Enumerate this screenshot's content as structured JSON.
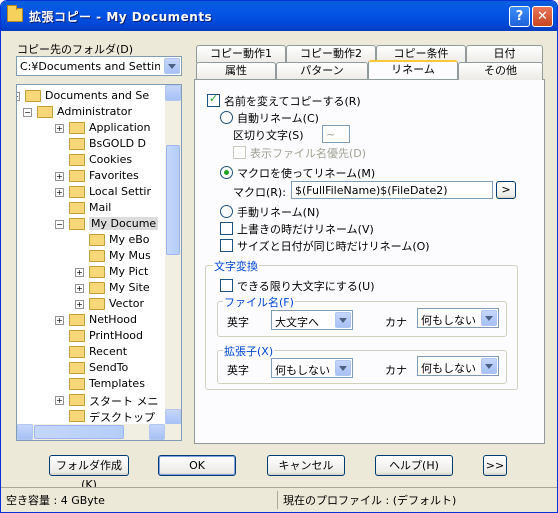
{
  "window": {
    "title": "拡張コピー - My Documents",
    "help": "?",
    "close": "✕"
  },
  "dest": {
    "label": "コピー先のフォルダ(D)",
    "path": "C:¥Documents and Settings¥"
  },
  "tree": [
    {
      "label": "Documents and Se",
      "level": 0,
      "expander": "−",
      "open": true
    },
    {
      "label": "Administrator",
      "level": 1,
      "expander": "−",
      "open": true
    },
    {
      "label": "Application",
      "level": 2,
      "expander": "+"
    },
    {
      "label": "BsGOLD D",
      "level": 2,
      "expander": ""
    },
    {
      "label": "Cookies",
      "level": 2,
      "expander": ""
    },
    {
      "label": "Favorites",
      "level": 2,
      "expander": "+"
    },
    {
      "label": "Local Settir",
      "level": 2,
      "expander": "+"
    },
    {
      "label": "Mail",
      "level": 2,
      "expander": ""
    },
    {
      "label": "My Docume",
      "level": 2,
      "expander": "−",
      "open": true,
      "selected": true
    },
    {
      "label": "My eBo",
      "level": 3,
      "expander": ""
    },
    {
      "label": "My Mus",
      "level": 3,
      "expander": ""
    },
    {
      "label": "My Pict",
      "level": 3,
      "expander": "+"
    },
    {
      "label": "My Site",
      "level": 3,
      "expander": "+"
    },
    {
      "label": "Vector",
      "level": 3,
      "expander": "+"
    },
    {
      "label": "NetHood",
      "level": 2,
      "expander": "+"
    },
    {
      "label": "PrintHood",
      "level": 2,
      "expander": ""
    },
    {
      "label": "Recent",
      "level": 2,
      "expander": ""
    },
    {
      "label": "SendTo",
      "level": 2,
      "expander": ""
    },
    {
      "label": "Templates",
      "level": 2,
      "expander": ""
    },
    {
      "label": "スタート メニ",
      "level": 2,
      "expander": "+"
    },
    {
      "label": "デスクトップ",
      "level": 2,
      "expander": ""
    }
  ],
  "tabs": {
    "row1": [
      "コピー動作1",
      "コピー動作2",
      "コピー条件",
      "日付"
    ],
    "row2": [
      "属性",
      "パターン",
      "リネーム",
      "その他"
    ]
  },
  "rename": {
    "enable": "名前を変えてコピーする(R)",
    "auto": "自動リネーム(C)",
    "separator": "区切り文字(S)",
    "separator_value": "~",
    "prefer_display": "表示ファイル名優先(D)",
    "macro": "マクロを使ってリネーム(M)",
    "macro_label": "マクロ(R):",
    "macro_value": "$(FullFileName)$(FileDate2)",
    "macro_btn": ">",
    "manual": "手動リネーム(N)",
    "overwrite_only": "上書きの時だけリネーム(V)",
    "same_size_date": "サイズと日付が同じ時だけリネーム(O)"
  },
  "conv": {
    "title": "文字変換",
    "upper": "できる限り大文字にする(U)",
    "filename_title": "ファイル名(F)",
    "ext_title": "拡張子(X)",
    "eiji": "英字",
    "kana": "カナ",
    "fn_eiji": "大文字へ",
    "fn_kana": "何もしない",
    "ext_eiji": "何もしない",
    "ext_kana": "何もしない"
  },
  "buttons": {
    "mkdir": "フォルダ作成(K)",
    "ok": "OK",
    "cancel": "キャンセル",
    "help": "ヘルプ(H)",
    "more": ">>"
  },
  "status": {
    "free": "空き容量 : 4 GByte",
    "profile": "現在のプロファイル : (デフォルト)"
  },
  "colors": {
    "accent": "#0046d5",
    "titlebar": "#0454e6",
    "tab_highlight": "#ffc83c"
  }
}
